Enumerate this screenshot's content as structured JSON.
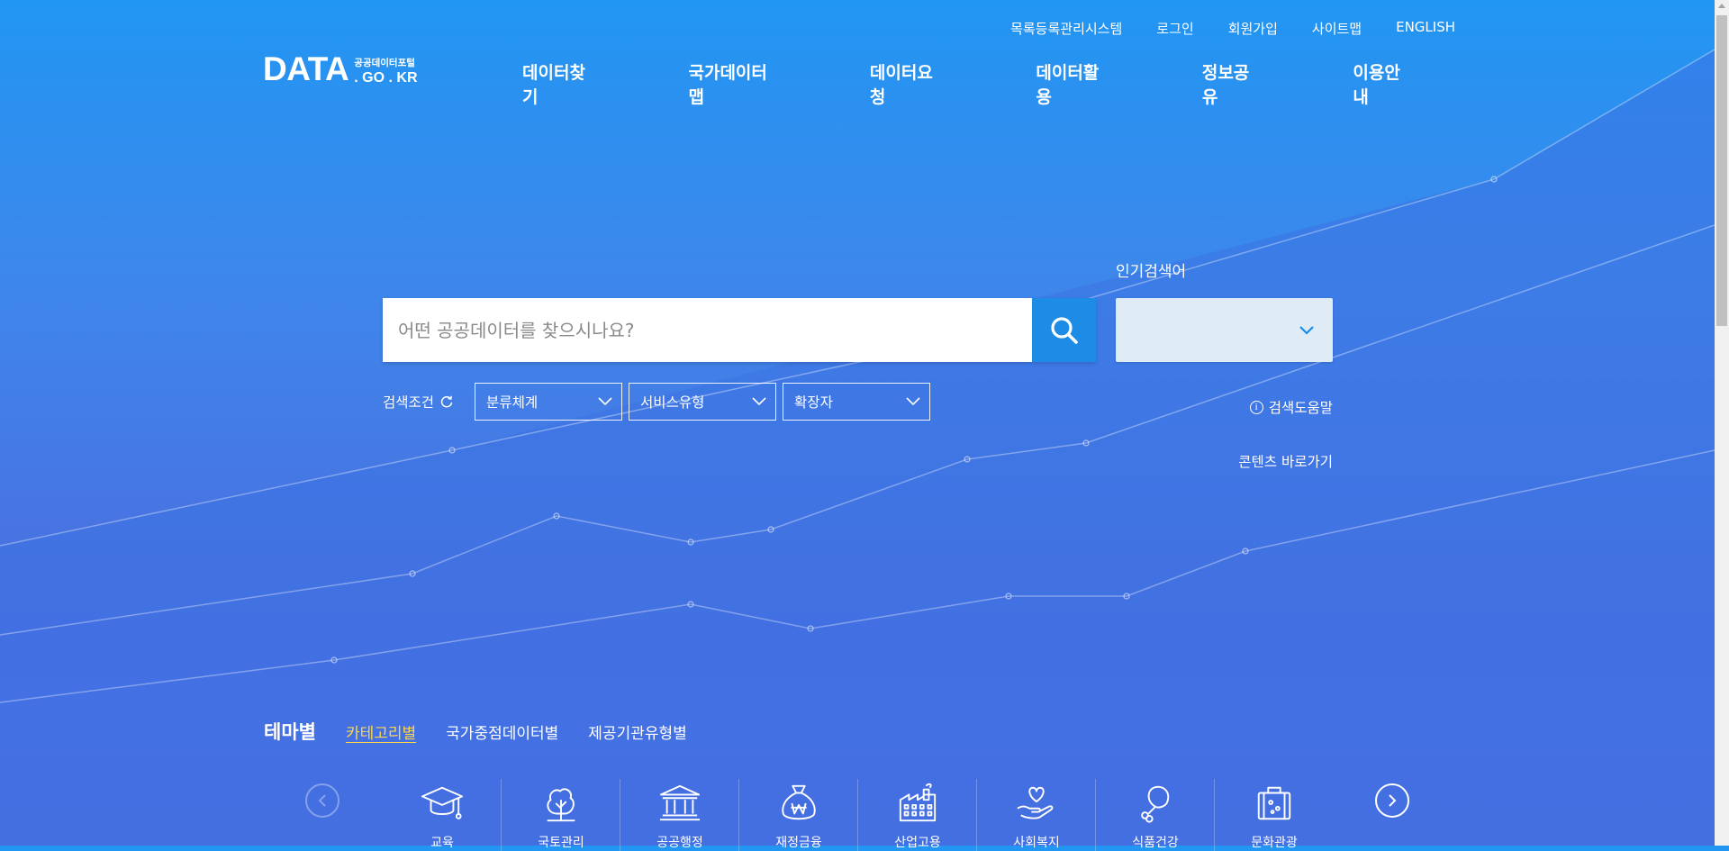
{
  "utility_nav": [
    "목록등록관리시스템",
    "로그인",
    "회원가입",
    "사이트맵",
    "ENGLISH"
  ],
  "logo": {
    "main": "DATA",
    "sub_ko": "공공데이터포털",
    "sub_en": ". GO . KR"
  },
  "gnb": [
    "데이터찾기",
    "국가데이터맵",
    "데이터요청",
    "데이터활용",
    "정보공유",
    "이용안내"
  ],
  "search": {
    "placeholder": "어떤 공공데이터를 찾으시나요?",
    "value": ""
  },
  "popular": {
    "label": "인기검색어",
    "selected": ""
  },
  "filters": {
    "label": "검색조건",
    "selects": [
      "분류체계",
      "서비스유형",
      "확장자"
    ]
  },
  "help": {
    "icon": "info-icon",
    "label": "검색도움말"
  },
  "shortcut": "콘텐츠 바로가기",
  "theme_tabs": {
    "title": "테마별",
    "tabs": [
      {
        "label": "카테고리별",
        "active": true
      },
      {
        "label": "국가중점데이터별",
        "active": false
      },
      {
        "label": "제공기관유형별",
        "active": false
      }
    ]
  },
  "categories": [
    {
      "icon": "graduation-cap-icon",
      "label": "교육"
    },
    {
      "icon": "tree-icon",
      "label": "국토관리"
    },
    {
      "icon": "government-building-icon",
      "label": "공공행정"
    },
    {
      "icon": "money-bag-icon",
      "label": "재정금융"
    },
    {
      "icon": "factory-icon",
      "label": "산업고용"
    },
    {
      "icon": "heart-hand-icon",
      "label": "사회복지"
    },
    {
      "icon": "chicken-leg-icon",
      "label": "식품건강"
    },
    {
      "icon": "suitcase-icon",
      "label": "문화관광"
    }
  ],
  "colors": {
    "accent": "#1c8ce6",
    "active_tab": "#ffd54a",
    "select_bg": "#dfecf6"
  }
}
